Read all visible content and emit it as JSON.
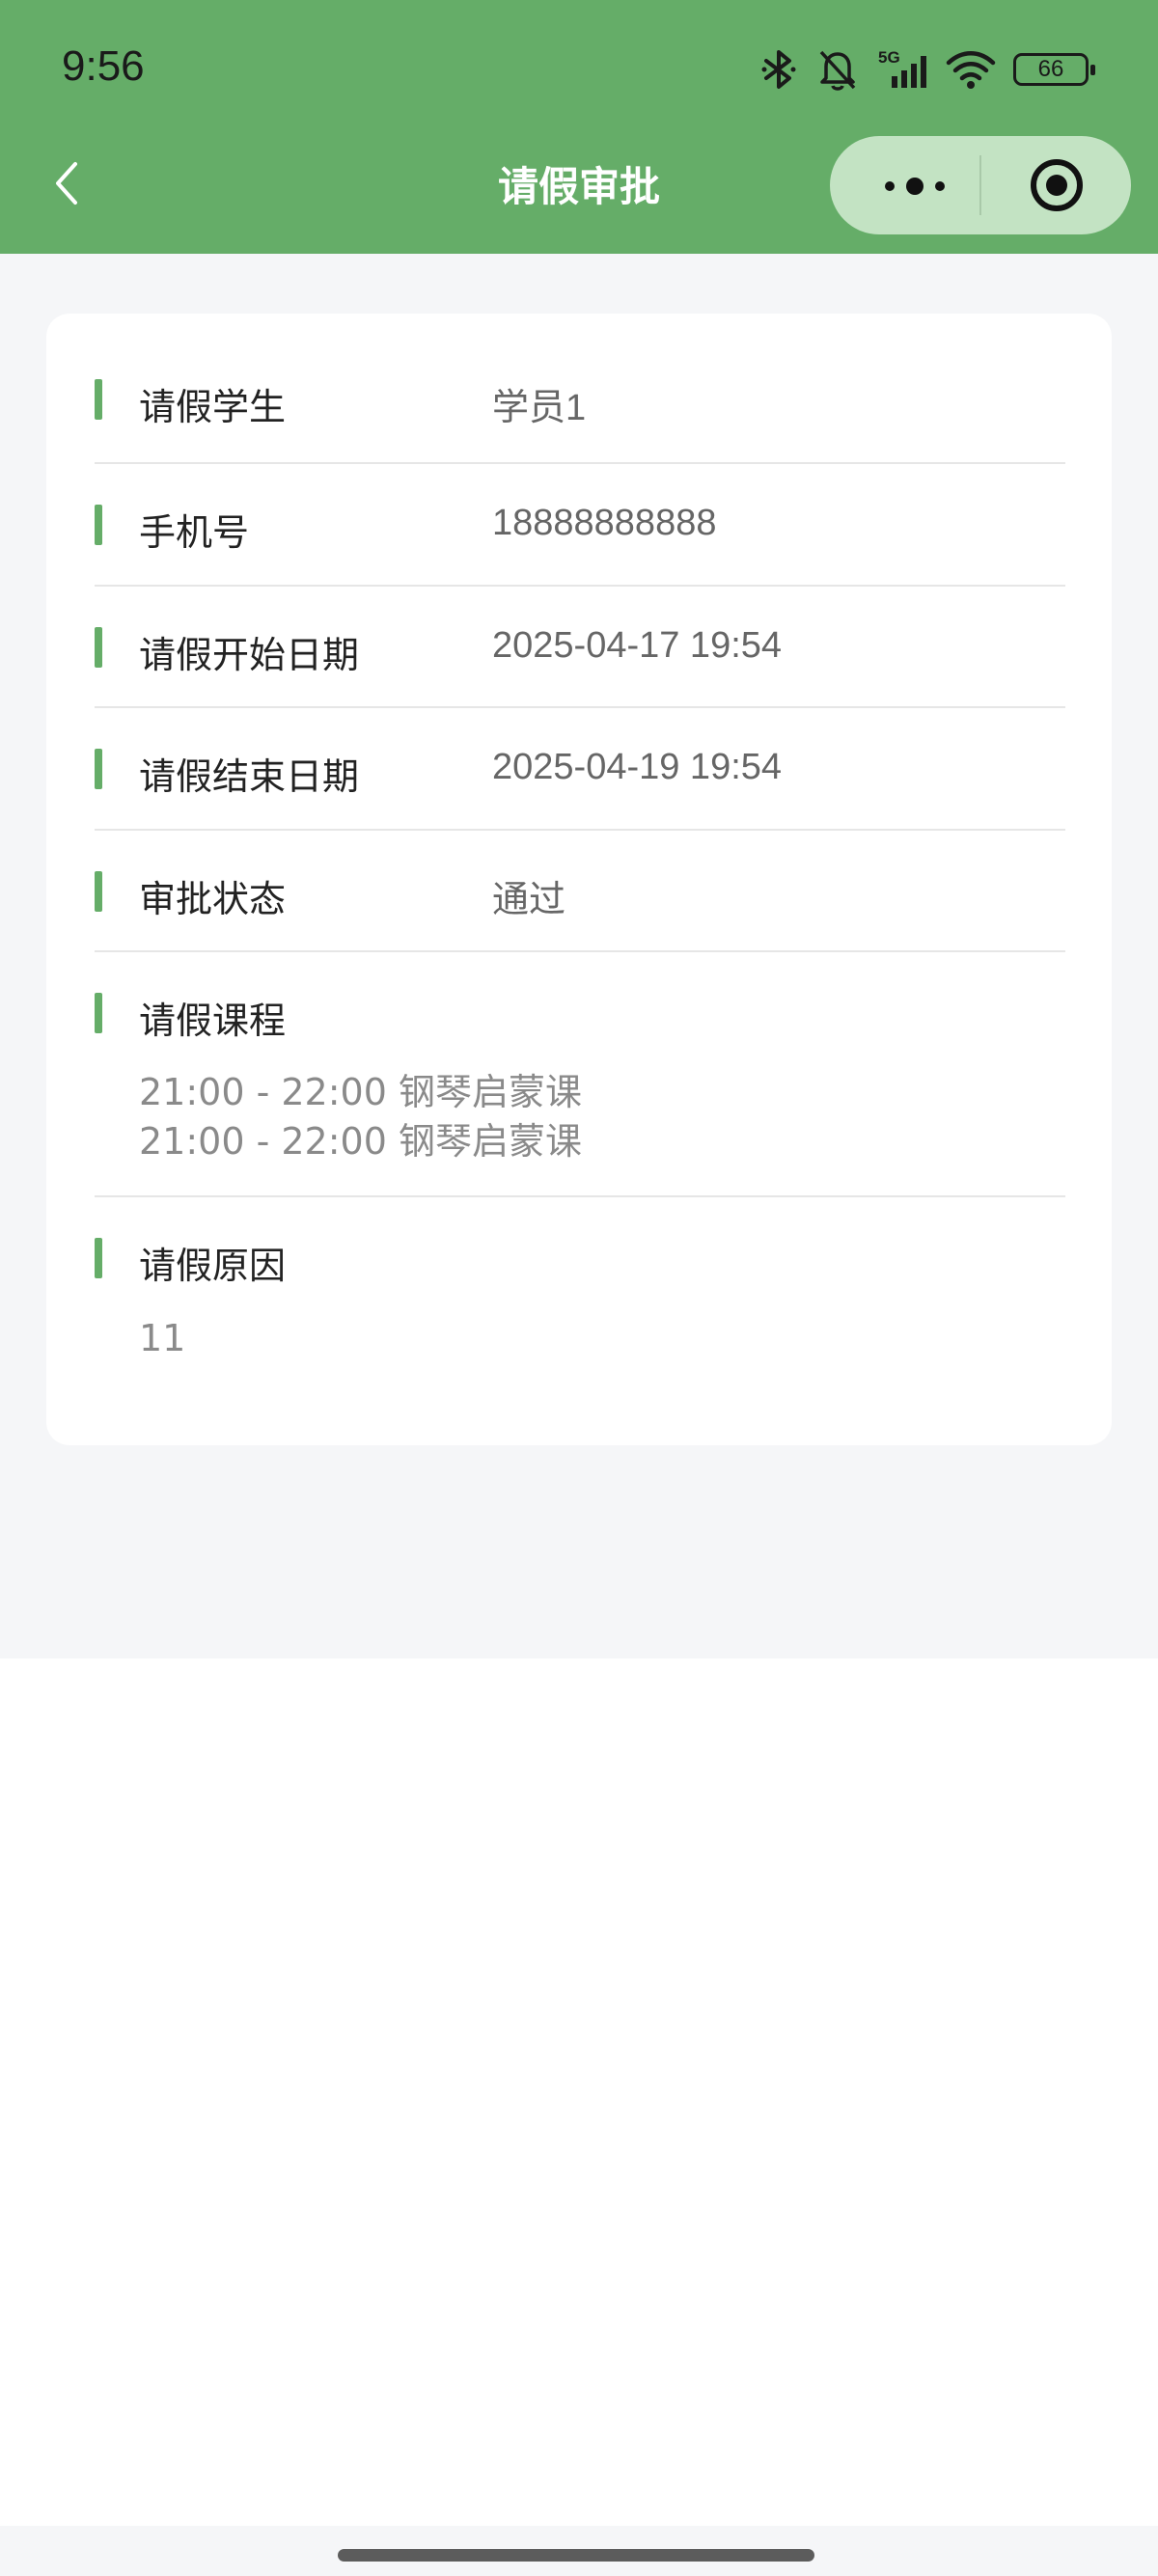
{
  "status_bar": {
    "time": "9:56",
    "network": "5G",
    "battery": "66",
    "icons": [
      "bluetooth-icon",
      "bell-muted-icon",
      "signal-icon",
      "wifi-icon",
      "battery-icon"
    ]
  },
  "nav": {
    "title": "请假审批",
    "back_icon": "chevron-left-icon",
    "capsule_icons": [
      "more-dots-icon",
      "target-close-icon"
    ]
  },
  "details": {
    "student": {
      "label": "请假学生",
      "value": "学员1"
    },
    "phone": {
      "label": "手机号",
      "value": "18888888888"
    },
    "start_date": {
      "label": "请假开始日期",
      "value": "2025-04-17 19:54"
    },
    "end_date": {
      "label": "请假结束日期",
      "value": "2025-04-19 19:54"
    },
    "status": {
      "label": "审批状态",
      "value": "通过"
    },
    "courses": {
      "label": "请假课程",
      "items": [
        "21:00 - 22:00 钢琴启蒙课",
        "21:00 - 22:00 钢琴启蒙课"
      ]
    },
    "reason": {
      "label": "请假原因",
      "value": "11"
    }
  },
  "colors": {
    "accent": "#65ad68",
    "capsule": "#c3e3c3",
    "page_bg": "#f5f6f8",
    "card_bg": "#ffffff"
  }
}
